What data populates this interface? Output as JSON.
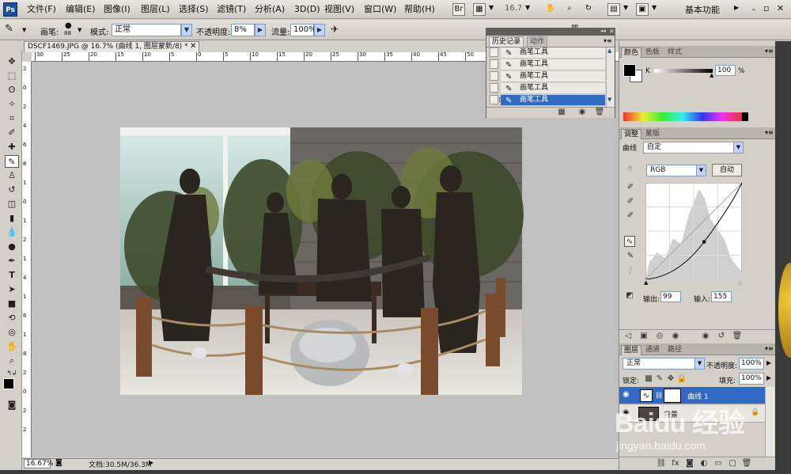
{
  "app": {
    "logo": "Ps",
    "menu": [
      "文件(F)",
      "编辑(E)",
      "图像(I)",
      "图层(L)",
      "选择(S)",
      "滤镜(T)",
      "分析(A)",
      "3D(D)",
      "视图(V)",
      "窗口(W)",
      "帮助(H)"
    ],
    "zoom": "16.7",
    "workspace": "基本功能"
  },
  "options": {
    "brush_label": "画笔:",
    "brush_size": "88",
    "mode_label": "模式:",
    "mode_value": "正常",
    "opacity_label": "不透明度:",
    "opacity_value": "8%",
    "flow_label": "流量:",
    "flow_value": "100%"
  },
  "document": {
    "tab_title": "DSCF1469.JPG @ 16.7% (曲线 1, 图层蒙新/8) *",
    "ruler_top": [
      "30",
      "25",
      "20",
      "15",
      "10",
      "5",
      "0",
      "5",
      "10",
      "15",
      "20",
      "25",
      "30",
      "35",
      "40",
      "45",
      "50",
      "55",
      "60",
      "65",
      "70"
    ],
    "ruler_left": [
      "2",
      "0",
      "2",
      "4",
      "6",
      "8",
      "1",
      "0",
      "1",
      "2",
      "1",
      "4",
      "1",
      "6",
      "1",
      "8",
      "2",
      "0",
      "2",
      "2"
    ],
    "status_zoom": "16.67%",
    "status_doc": "文档:30.5M/36.3M"
  },
  "history": {
    "tabs": [
      "历史记录",
      "动作"
    ],
    "items": [
      "画笔工具",
      "画笔工具",
      "画笔工具",
      "画笔工具",
      "画笔工具"
    ],
    "selected_index": 4
  },
  "color_panel": {
    "tabs": [
      "颜色",
      "色板",
      "样式"
    ],
    "channel": "K",
    "value": "100",
    "unit": "%"
  },
  "adjust_panel": {
    "tabs": [
      "调整",
      "蒙版"
    ],
    "curve_label": "曲线",
    "preset": "自定",
    "channel": "RGB",
    "auto_label": "自动",
    "output_label": "输出:",
    "output_value": "99",
    "input_label": "输入:",
    "input_value": "155",
    "curve_point": {
      "input": 155,
      "output": 99
    }
  },
  "layers_panel": {
    "tabs": [
      "图层",
      "通道",
      "路径"
    ],
    "blend_mode": "正常",
    "opacity_label": "不透明度:",
    "opacity_value": "100%",
    "lock_label": "锁定:",
    "fill_label": "填充:",
    "fill_value": "100%",
    "layers": [
      {
        "name": "曲线 1"
      },
      {
        "name": "背景"
      }
    ]
  },
  "watermark": {
    "line1": "Baidu 经验",
    "line2": "jingyan.baidu.com"
  },
  "colors": {
    "accent": "#316ac5",
    "panel_bg": "#d4d0c8",
    "canvas_bg": "#c0c0c0"
  }
}
